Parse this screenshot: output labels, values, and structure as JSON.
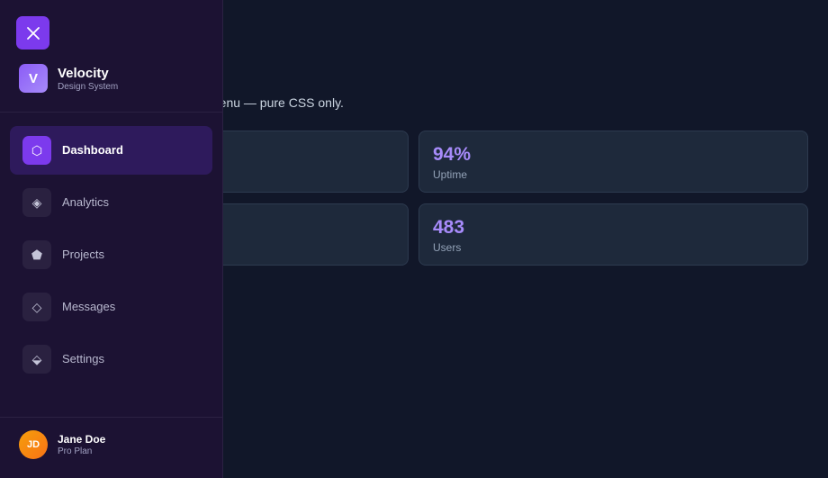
{
  "main": {
    "subtitle": "menu — pure CSS only.",
    "stats": [
      {
        "value": "",
        "label": ""
      },
      {
        "value": "94%",
        "label": "Uptime"
      },
      {
        "value": "",
        "label": ""
      },
      {
        "value": "483",
        "label": "Users"
      }
    ]
  },
  "drawer": {
    "close_icon": "close-icon",
    "brand": {
      "logo_letter": "V",
      "name": "Velocity",
      "subtitle": "Design System"
    },
    "nav": [
      {
        "label": "Dashboard",
        "icon": "hexagon-icon",
        "glyph": "⬡",
        "active": true
      },
      {
        "label": "Analytics",
        "icon": "diamond-icon",
        "glyph": "◈",
        "active": false
      },
      {
        "label": "Projects",
        "icon": "pentagon-icon",
        "glyph": "⬟",
        "active": false
      },
      {
        "label": "Messages",
        "icon": "diamond-outline-icon",
        "glyph": "◇",
        "active": false
      },
      {
        "label": "Settings",
        "icon": "settings-icon",
        "glyph": "⬙",
        "active": false
      }
    ],
    "user": {
      "initials": "JD",
      "name": "Jane Doe",
      "plan": "Pro Plan"
    }
  },
  "colors": {
    "accent": "#7c3aed",
    "accent_text": "#a78bfa",
    "drawer_bg": "#1c1233",
    "page_bg": "#111729",
    "card_bg": "#1e293b"
  }
}
